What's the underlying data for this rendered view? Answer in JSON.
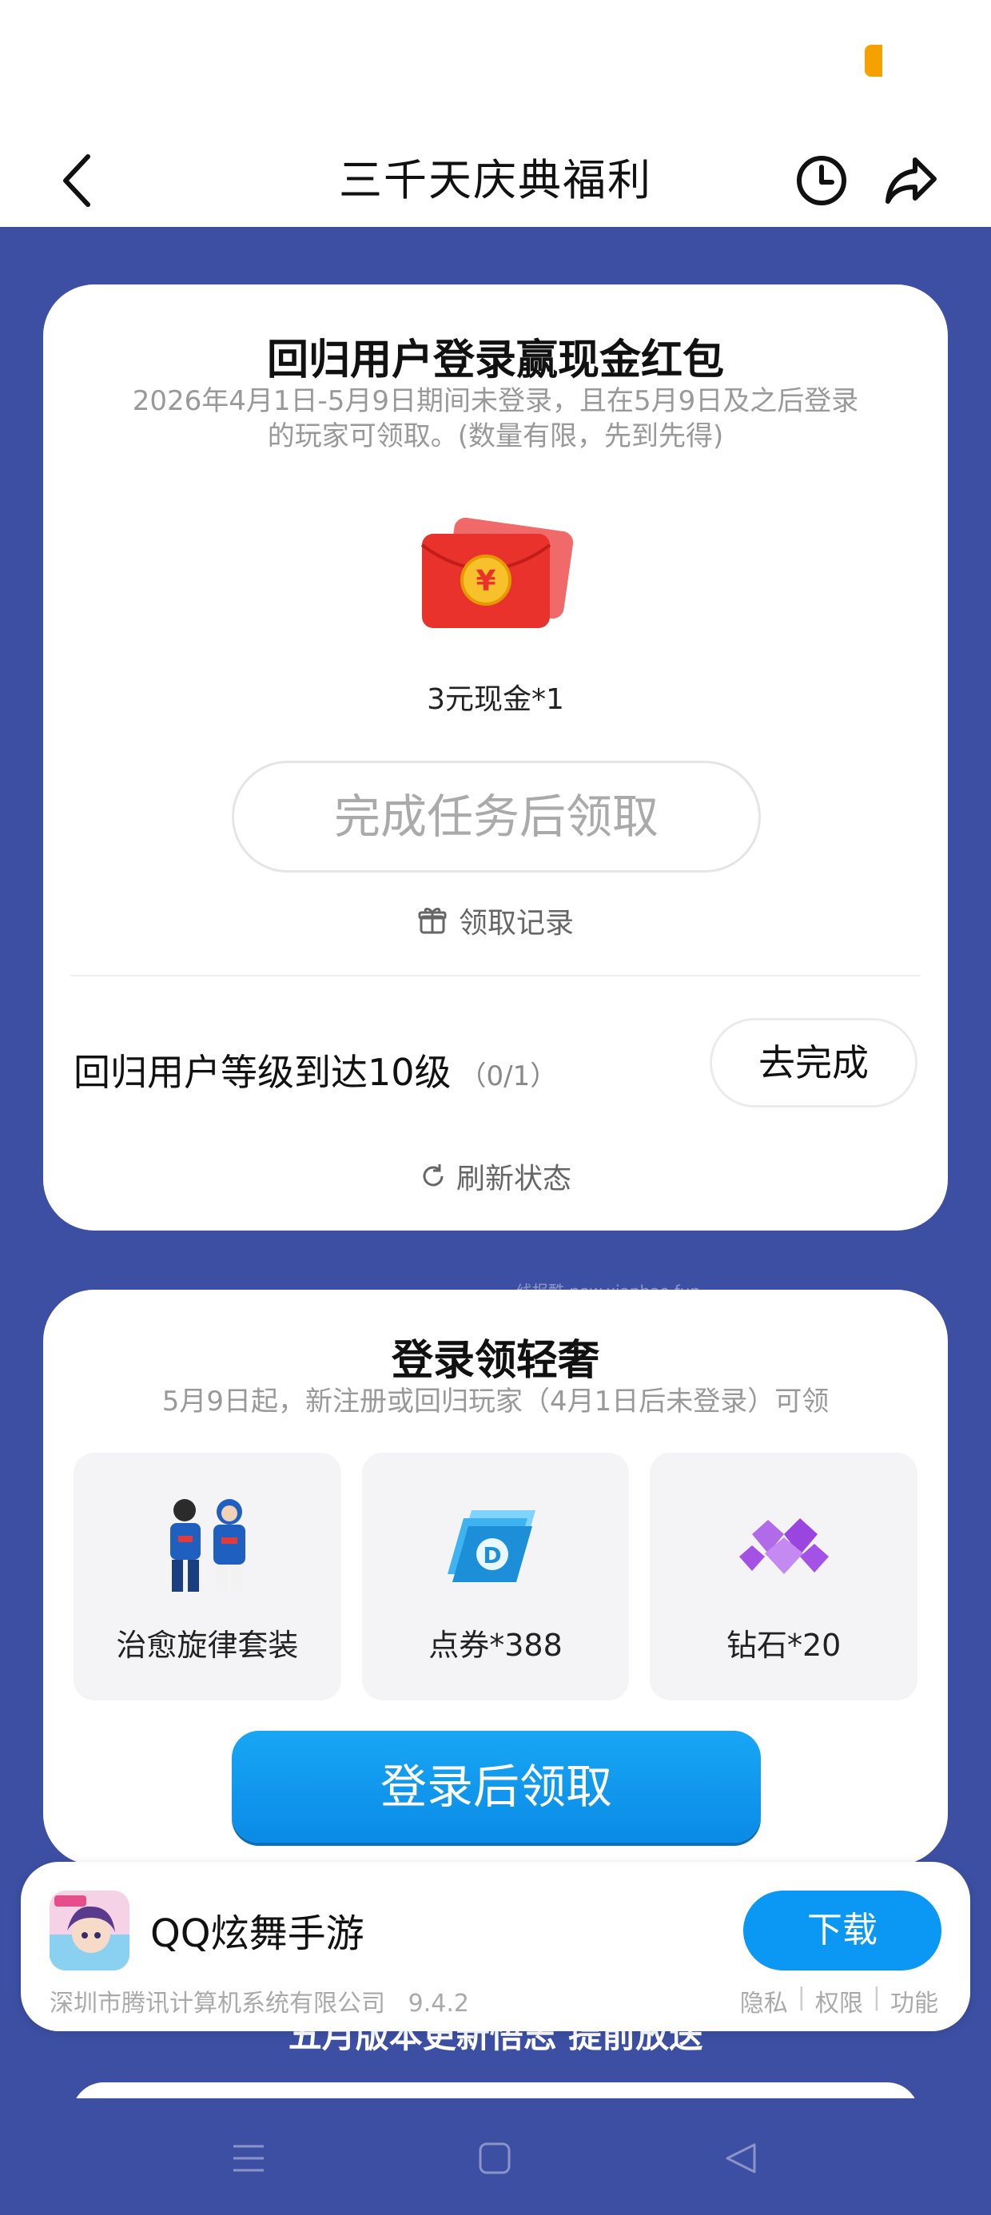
{
  "header": {
    "title": "三千天庆典福利",
    "back_icon": "chevron-left-icon",
    "history_icon": "clock-icon",
    "share_icon": "share-arrow-icon"
  },
  "return_card": {
    "title": "回归用户登录赢现金红包",
    "subtitle_line1": "2026年4月1日-5月9日期间未登录，且在5月9日及之后登录",
    "subtitle_line2": "的玩家可领取。(数量有限，先到先得)",
    "reward_label": "3元现金*1",
    "reward_icon": "red-packet-icon",
    "claim_button": "完成任务后领取",
    "records_label": "领取记录",
    "task_label": "回归用户等级到达10级",
    "task_progress": "（0/1）",
    "task_button": "去完成",
    "refresh_label": "刷新状态"
  },
  "watermark": "线报酷 new.xianbao.fun",
  "login_card": {
    "title": "登录领轻奢",
    "subtitle": "5月9日起，新注册或回归玩家（4月1日后未登录）可领",
    "rewards": [
      {
        "label": "治愈旋律套装",
        "icon": "outfit-couple-icon"
      },
      {
        "label": "点券*388",
        "icon": "coupon-stack-icon"
      },
      {
        "label": "钻石*20",
        "icon": "diamonds-icon"
      }
    ],
    "login_button": "登录后领取"
  },
  "behind_text": "五月版本更新悟志 提前放送",
  "app_banner": {
    "name": "QQ炫舞手游",
    "download_button": "下载",
    "developer": "深圳市腾讯计算机系统有限公司",
    "version": "9.4.2",
    "link_privacy": "隐私",
    "link_permissions": "权限",
    "link_features": "功能",
    "icon": "app-icon"
  },
  "colors": {
    "page_bg": "#3d4fa3",
    "accent_blue": "#0b97f4",
    "status_pill": "#f5a100"
  }
}
